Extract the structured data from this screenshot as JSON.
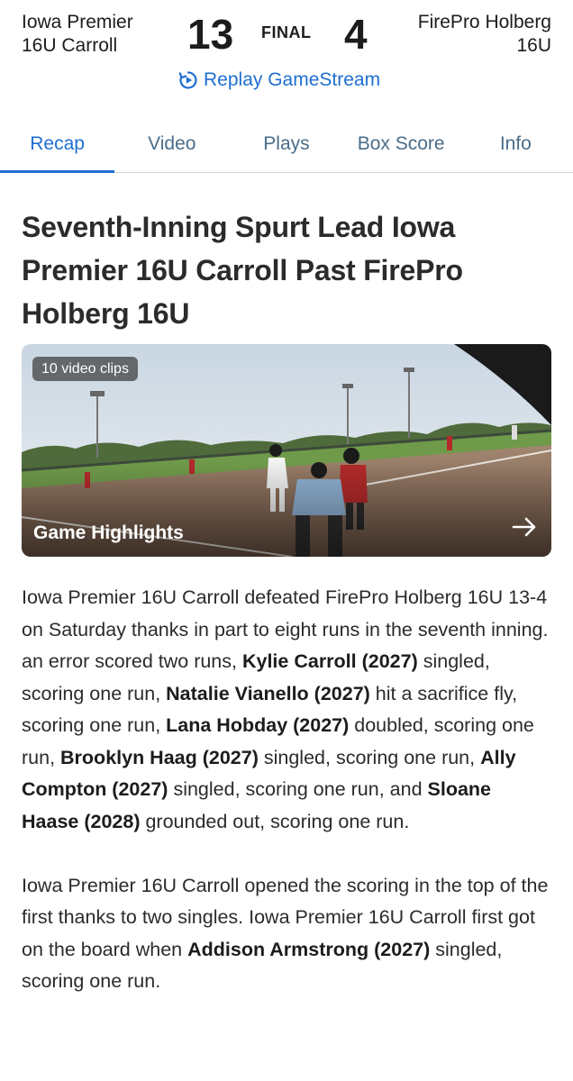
{
  "scoreboard": {
    "home_team_line1": "Iowa Premier",
    "home_team_line2": "16U Carroll",
    "home_score": "13",
    "status": "FINAL",
    "away_score": "4",
    "away_team_line1": "FirePro Holberg",
    "away_team_line2": "16U",
    "replay_label": "Replay GameStream",
    "replay_icon": "replay-icon"
  },
  "tabs": [
    {
      "label": "Recap",
      "active": true
    },
    {
      "label": "Video",
      "active": false
    },
    {
      "label": "Plays",
      "active": false
    },
    {
      "label": "Box Score",
      "active": false
    },
    {
      "label": "Info",
      "active": false
    }
  ],
  "article": {
    "headline": "Seventh-Inning Spurt Lead Iowa Premier 16U Carroll Past FirePro Holberg 16U",
    "highlights": {
      "badge": "10 video clips",
      "title": "Game Highlights",
      "arrow_icon": "arrow-right-icon"
    },
    "para1": {
      "t1": "Iowa Premier 16U Carroll defeated FirePro Holberg 16U 13-4 on Saturday thanks in part to eight runs in the seventh inning.  an error scored two runs, ",
      "b1": "Kylie Carroll (2027)",
      "t2": " singled, scoring one run, ",
      "b2": "Natalie Vianello (2027)",
      "t3": " hit a sacrifice fly, scoring one run, ",
      "b3": "Lana Hobday (2027)",
      "t4": " doubled, scoring one run, ",
      "b4": "Brooklyn Haag (2027)",
      "t5": " singled, scoring one run, ",
      "b5": "Ally Compton (2027)",
      "t6": " singled, scoring one run, and ",
      "b6": "Sloane Haase (2028)",
      "t7": " grounded out, scoring one run."
    },
    "para2": {
      "t1": "Iowa Premier 16U Carroll opened the scoring in the top of the first thanks to two singles. Iowa Premier 16U Carroll first got on the board when ",
      "b1": "Addison Armstrong (2027)",
      "t2": " singled, scoring one run."
    }
  },
  "colors": {
    "accent": "#1f6fd1",
    "tab_inactive": "#4a6d8a",
    "text": "#2b2b2e"
  }
}
